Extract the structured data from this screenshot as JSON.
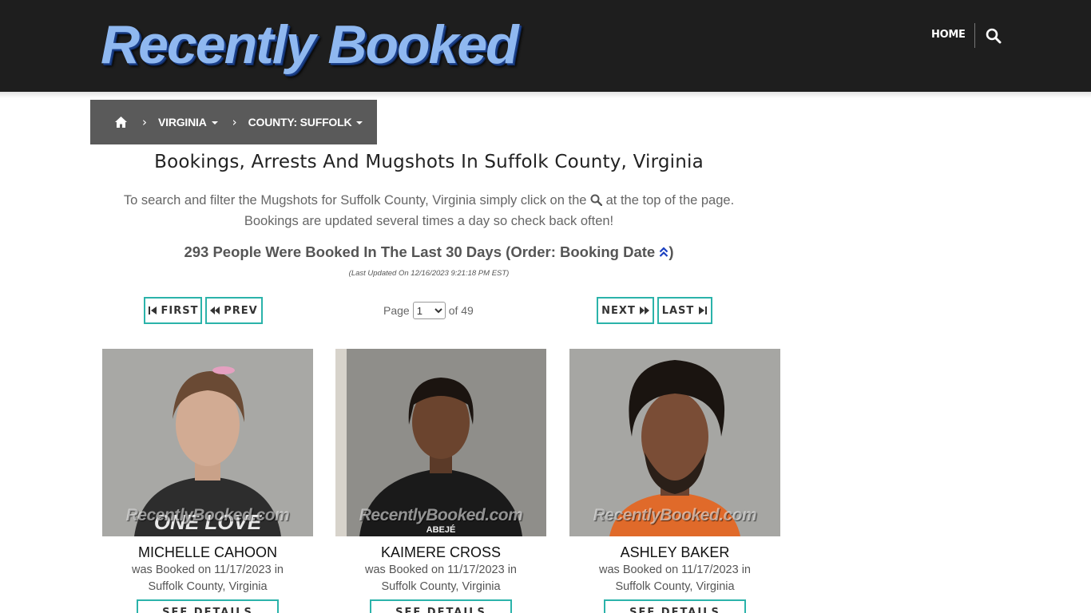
{
  "header": {
    "logo_text": "Recently Booked",
    "nav": {
      "home_label": "HOME"
    }
  },
  "breadcrumb": {
    "items": [
      {
        "label": "VIRGINIA"
      },
      {
        "label": "COUNTY: SUFFOLK"
      }
    ]
  },
  "main": {
    "title": "Bookings, Arrests And Mugshots In Suffolk County, Virginia",
    "intro_part1": "To search and filter the Mugshots for Suffolk County, Virginia simply click on the",
    "intro_part2": "at the top of the page.",
    "intro_line2": "Bookings are updated several times a day so check back often!",
    "count_text": "293 People Were Booked In The Last 30 Days (Order: Booking Date",
    "count_close": ")",
    "last_updated": "(Last Updated On 12/16/2023 9:21:18 PM EST)"
  },
  "pager": {
    "first_label": "FIRST",
    "prev_label": "PREV",
    "next_label": "NEXT",
    "last_label": "LAST",
    "page_label": "Page",
    "current_page": "1",
    "of_label": "of 49"
  },
  "bookings": [
    {
      "name": "MICHELLE CAHOON",
      "line1": "was Booked on 11/17/2023 in",
      "line2": "Suffolk County, Virginia",
      "watermark": "RecentlyBooked.com",
      "shirt_text": "ONE LOVE"
    },
    {
      "name": "KAIMERE CROSS",
      "line1": "was Booked on 11/17/2023 in",
      "line2": "Suffolk County, Virginia",
      "watermark": "RecentlyBooked.com",
      "shirt_text": "ABEJÉ"
    },
    {
      "name": "ASHLEY BAKER",
      "line1": "was Booked on 11/17/2023 in",
      "line2": "Suffolk County, Virginia",
      "watermark": "RecentlyBooked.com",
      "shirt_text": ""
    }
  ],
  "card_button_label": "SEE DETAILS",
  "colors": {
    "header_bg": "#1e1e1e",
    "breadcrumb_bg": "#5a5a5a",
    "accent_teal": "#2bb3aa",
    "sort_icon": "#1a3fc0"
  }
}
